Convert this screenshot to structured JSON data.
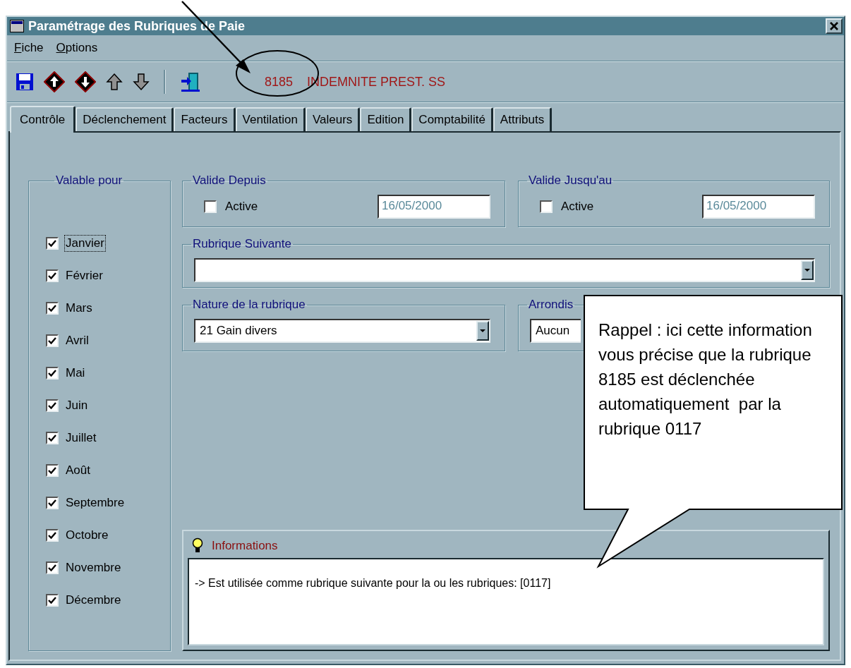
{
  "window": {
    "title": "Paramétrage des Rubriques de Paie"
  },
  "menu": [
    "Fiche",
    "Options"
  ],
  "toolbar": {
    "record_code": "8185",
    "record_name": "INDEMNITE PREST. SS"
  },
  "tabs": [
    {
      "label": "Contrôle",
      "selected": true
    },
    {
      "label": "Déclenchement",
      "selected": false
    },
    {
      "label": "Facteurs",
      "selected": false
    },
    {
      "label": "Ventilation",
      "selected": false
    },
    {
      "label": "Valeurs",
      "selected": false
    },
    {
      "label": "Edition",
      "selected": false
    },
    {
      "label": "Comptabilité",
      "selected": false
    },
    {
      "label": "Attributs",
      "selected": false
    }
  ],
  "valable_pour": {
    "label": "Valable pour",
    "months": [
      {
        "label": "Janvier",
        "checked": true,
        "focused": true
      },
      {
        "label": "Février",
        "checked": true,
        "focused": false
      },
      {
        "label": "Mars",
        "checked": true,
        "focused": false
      },
      {
        "label": "Avril",
        "checked": true,
        "focused": false
      },
      {
        "label": "Mai",
        "checked": true,
        "focused": false
      },
      {
        "label": "Juin",
        "checked": true,
        "focused": false
      },
      {
        "label": "Juillet",
        "checked": true,
        "focused": false
      },
      {
        "label": "Août",
        "checked": true,
        "focused": false
      },
      {
        "label": "Septembre",
        "checked": true,
        "focused": false
      },
      {
        "label": "Octobre",
        "checked": true,
        "focused": false
      },
      {
        "label": "Novembre",
        "checked": true,
        "focused": false
      },
      {
        "label": "Décembre",
        "checked": true,
        "focused": false
      }
    ]
  },
  "valide_depuis": {
    "label": "Valide Depuis",
    "active": {
      "label": "Active",
      "checked": false
    },
    "date": "16/05/2000"
  },
  "valide_jusqu_au": {
    "label": "Valide Jusqu'au",
    "active": {
      "label": "Active",
      "checked": false
    },
    "date": "16/05/2000"
  },
  "rubrique_suivante": {
    "label": "Rubrique Suivante"
  },
  "nature": {
    "label": "Nature de la rubrique",
    "value": "21 Gain divers"
  },
  "arrondis": {
    "label": "Arrondis",
    "value": "Aucun"
  },
  "informations": {
    "title": "Informations",
    "text": "-> Est utilisée comme rubrique suivante pour la ou les rubriques: [0117]"
  },
  "annotation": {
    "text": "Rappel : ici cette information vous précise que la rubrique 8185 est déclenchée automatiquement  par la rubrique 0117"
  }
}
